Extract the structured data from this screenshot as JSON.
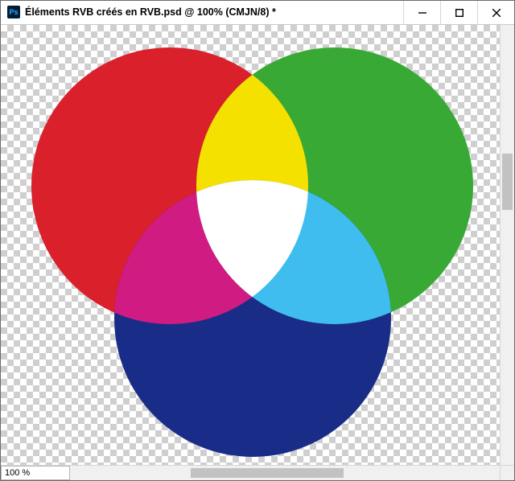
{
  "titlebar": {
    "app_icon_letters": "Ps",
    "document_title": "Éléments RVB créés en RVB.psd @ 100% (CMJN/8) *"
  },
  "statusbar": {
    "zoom_text": "100 %"
  },
  "venn_colors": {
    "red": "#d9202b",
    "green": "#39a935",
    "blue": "#192c87",
    "yellow": "#f5e100",
    "cyan": "#3ebdee",
    "magenta": "#d01b82",
    "white": "#ffffff"
  }
}
